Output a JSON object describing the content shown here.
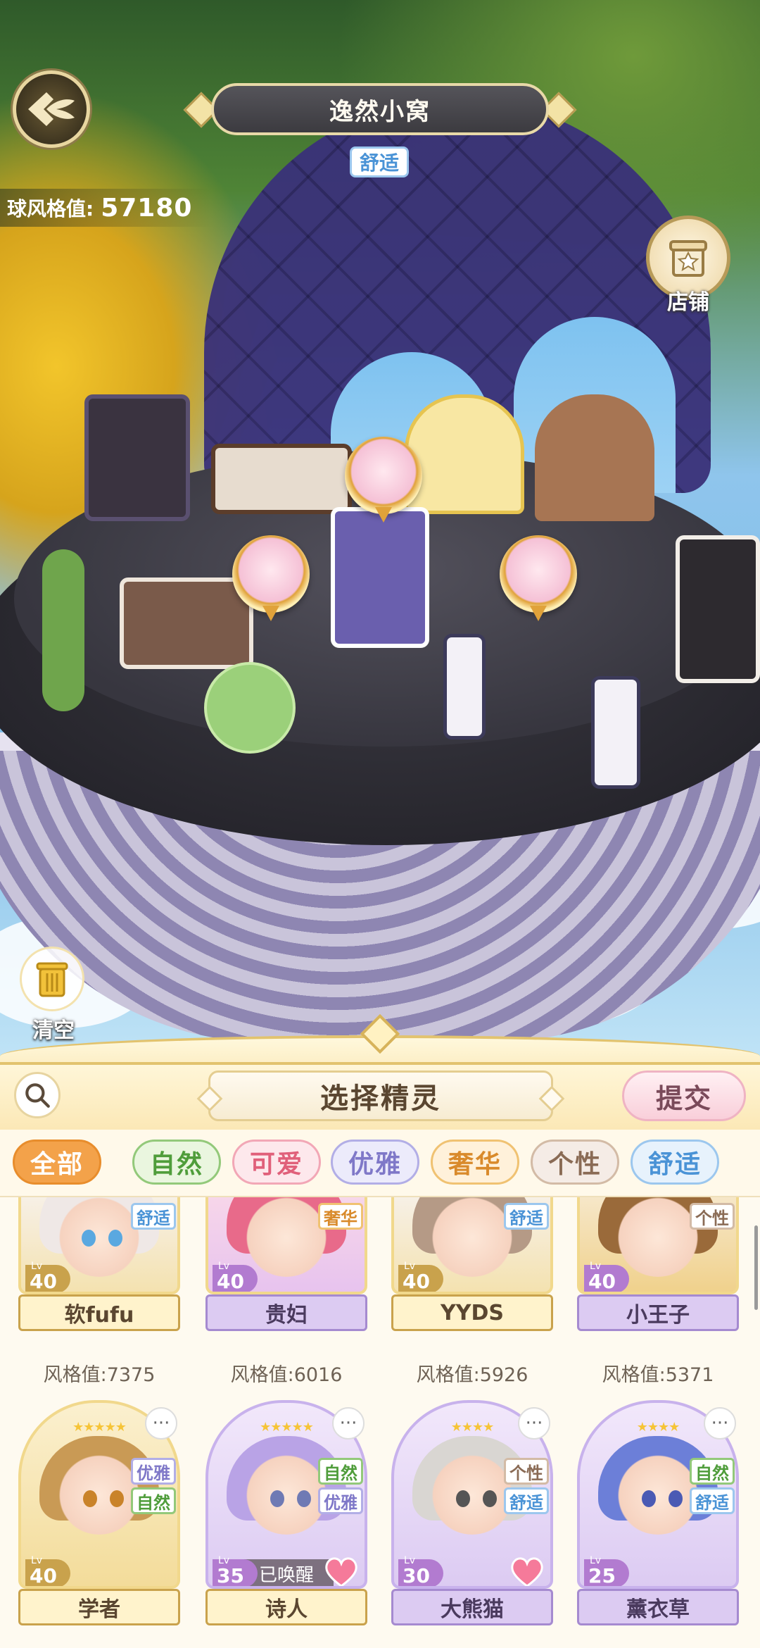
{
  "header": {
    "home_name": "逸然小窝",
    "home_tag": "舒适",
    "style_label": "球风格值:",
    "style_value": "57180",
    "shop_label": "店铺",
    "clear_label": "清空"
  },
  "panel": {
    "title": "选择精灵",
    "submit_label": "提交"
  },
  "filters": [
    {
      "label": "全部",
      "active": true
    },
    {
      "label": "自然"
    },
    {
      "label": "可爱"
    },
    {
      "label": "优雅"
    },
    {
      "label": "奢华"
    },
    {
      "label": "个性"
    },
    {
      "label": "舒适"
    }
  ],
  "cards_row1": [
    {
      "name": "软fufu",
      "level": "40",
      "tags": [
        "舒适"
      ],
      "score": "风格值:7375"
    },
    {
      "name": "贵妇",
      "level": "40",
      "tags": [
        "奢华"
      ],
      "score": "风格值:6016"
    },
    {
      "name": "YYDS",
      "level": "40",
      "tags": [
        "舒适"
      ],
      "score": "风格值:5926"
    },
    {
      "name": "小王子",
      "level": "40",
      "tags": [
        "个性"
      ],
      "score": "风格值:5371"
    }
  ],
  "cards_row2": [
    {
      "name": "学者",
      "level": "40",
      "tags": [
        "优雅",
        "自然"
      ],
      "stars": "★★★★★",
      "more": "···"
    },
    {
      "name": "诗人",
      "level": "35",
      "tags": [
        "自然",
        "优雅"
      ],
      "stars": "★★★★★",
      "more": "···",
      "status": "已唤醒"
    },
    {
      "name": "大熊猫",
      "level": "30",
      "tags": [
        "个性",
        "舒适"
      ],
      "stars": "★★★★",
      "more": "···"
    },
    {
      "name": "薰衣草",
      "level": "25",
      "tags": [
        "自然",
        "舒适"
      ],
      "stars": "★★★★",
      "more": "···"
    }
  ],
  "level_prefix": "Lv",
  "colors": {
    "accent_gold": "#e2c36e",
    "tag_comfort": "#4a93d6",
    "tag_luxury": "#d98a2b",
    "tag_natural": "#4f9d3b",
    "tag_cute": "#e0607a",
    "tag_elegant": "#7f78c8",
    "tag_personality": "#8a6b55"
  }
}
